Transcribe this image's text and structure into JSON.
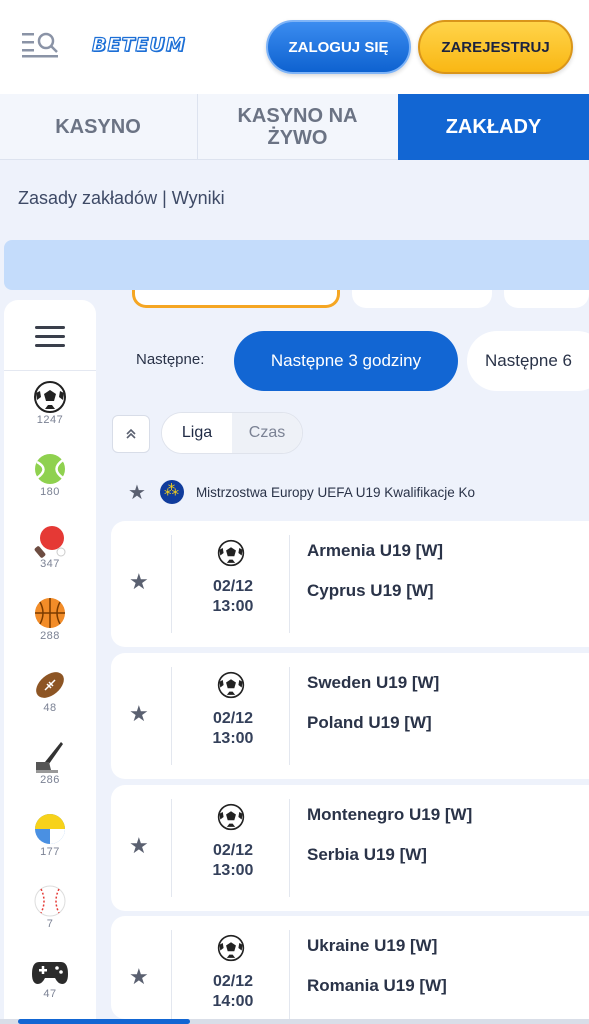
{
  "header": {
    "logo_text": "BETEUM",
    "login_label": "ZALOGUJ SIĘ",
    "register_label": "ZAREJESTRUJ"
  },
  "tabs": [
    {
      "label": "KASYNO",
      "active": false
    },
    {
      "label": "KASYNO NA ŻYWO",
      "active": true
    },
    {
      "label": "ZAKŁADY",
      "active": true
    }
  ],
  "links": "Zasady zakładów | Wyniki",
  "sidebar": {
    "sports": [
      {
        "icon": "soccer-ball-icon",
        "count": "1247"
      },
      {
        "icon": "tennis-ball-icon",
        "count": "180"
      },
      {
        "icon": "table-tennis-icon",
        "count": "347"
      },
      {
        "icon": "basketball-icon",
        "count": "288"
      },
      {
        "icon": "american-football-icon",
        "count": "48"
      },
      {
        "icon": "ice-hockey-icon",
        "count": "286"
      },
      {
        "icon": "volleyball-icon",
        "count": "177"
      },
      {
        "icon": "baseball-icon",
        "count": "7"
      },
      {
        "icon": "gamepad-icon",
        "count": "47"
      }
    ]
  },
  "filters": {
    "next_label": "Następne:",
    "active_option": "Następne 3 godziny",
    "next_option": "Następne 6"
  },
  "sort_toggle": {
    "league_label": "Liga",
    "time_label": "Czas"
  },
  "league_title": "Mistrzostwa Europy UEFA U19 Kwalifikacje Ko",
  "matches": [
    {
      "date": "02/12",
      "time": "13:00",
      "home": "Armenia U19 [W]",
      "away": "Cyprus U19 [W]"
    },
    {
      "date": "02/12",
      "time": "13:00",
      "home": "Sweden U19 [W]",
      "away": "Poland U19 [W]"
    },
    {
      "date": "02/12",
      "time": "13:00",
      "home": "Montenegro U19 [W]",
      "away": "Serbia U19 [W]"
    },
    {
      "date": "02/12",
      "time": "14:00",
      "home": "Ukraine U19 [W]",
      "away": "Romania U19 [W]"
    }
  ],
  "colors": {
    "primary_blue": "#1266d3",
    "register_yellow": "#f9b714",
    "page_bg": "#eef2fb"
  }
}
